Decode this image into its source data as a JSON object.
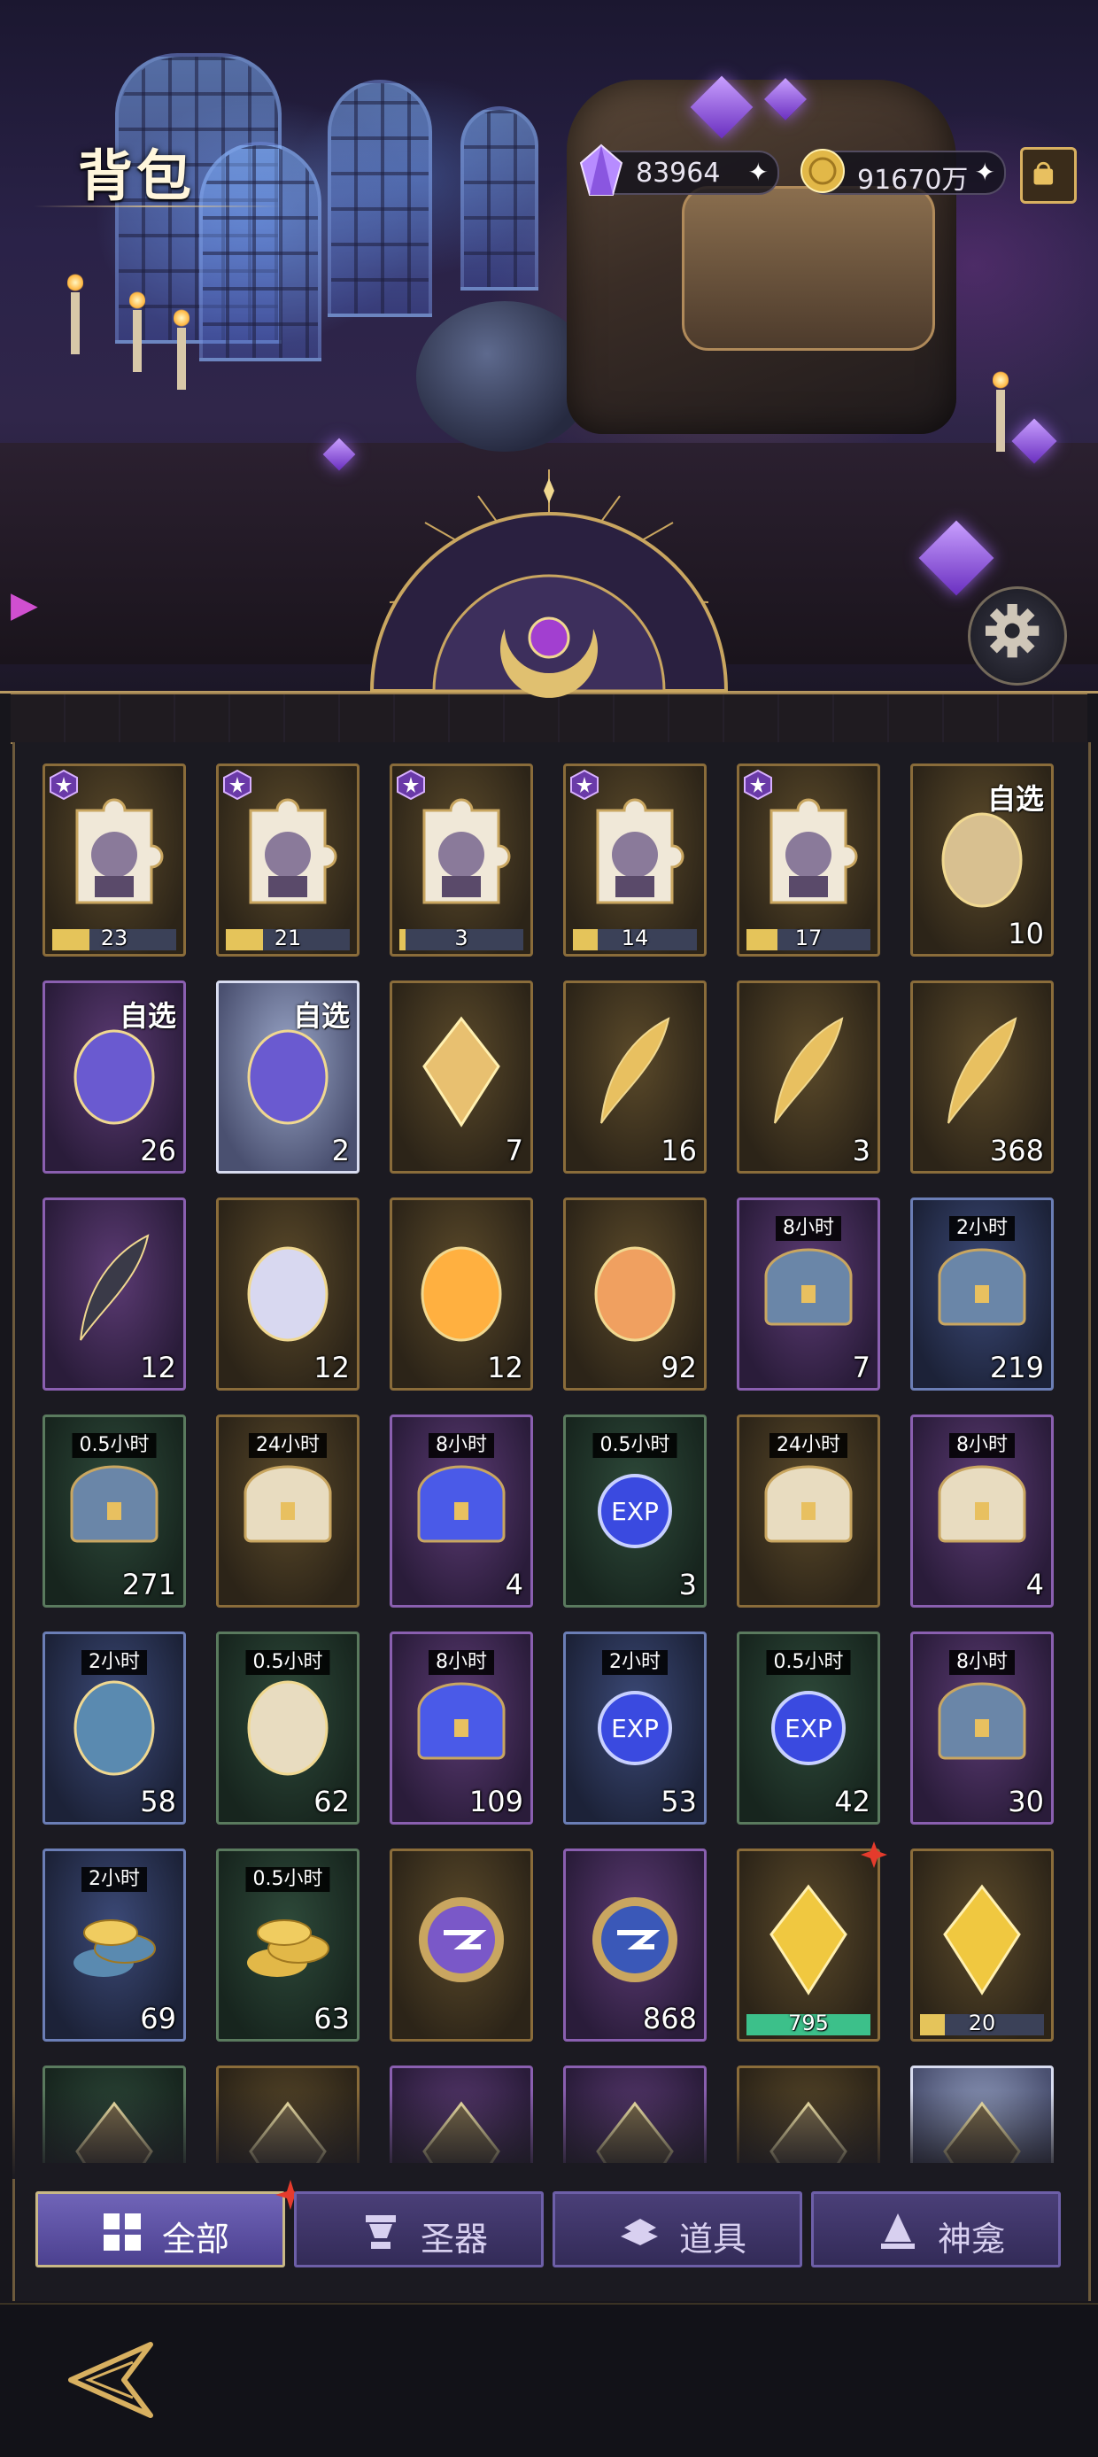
{
  "header": {
    "title": "背包",
    "crystal_amount": "83964",
    "coin_amount": "91670万"
  },
  "colors": {
    "gold_frame": "#8a6c3a",
    "purple_frame": "#8a5fb0",
    "blue_frame": "#6b7eb6",
    "green_frame": "#5a7a5e",
    "progress_gold": "#e5c45a",
    "progress_green": "#3cc08a",
    "tab_active": "#7064b8",
    "tab_inactive": "#4a3f78"
  },
  "inventory": {
    "rows": [
      [
        {
          "rarity": "gold",
          "icon": "puzzle-portrait-silver-hair-icon",
          "progress_label": "23",
          "progress": 0.3
        },
        {
          "rarity": "gold",
          "icon": "puzzle-portrait-dark-hair-icon",
          "progress_label": "21",
          "progress": 0.3
        },
        {
          "rarity": "gold",
          "icon": "puzzle-portrait-blonde-icon",
          "progress_label": "3",
          "progress": 0.05
        },
        {
          "rarity": "gold",
          "icon": "puzzle-portrait-black-hair-icon",
          "progress_label": "14",
          "progress": 0.2
        },
        {
          "rarity": "gold",
          "icon": "puzzle-portrait-dark-mask-icon",
          "progress_label": "17",
          "progress": 0.25
        },
        {
          "rarity": "gold",
          "icon": "golden-puzzle-icon",
          "pick": "自选",
          "count": "10"
        }
      ],
      [
        {
          "rarity": "purple",
          "icon": "tarot-card-icon",
          "pick": "自选",
          "count": "26"
        },
        {
          "rarity": "silver",
          "icon": "mystery-triangle-card-icon",
          "pick": "自选",
          "count": "2"
        },
        {
          "rarity": "gold",
          "icon": "crystal-key-icon",
          "count": "7"
        },
        {
          "rarity": "gold",
          "icon": "clover-feather-icon",
          "count": "16"
        },
        {
          "rarity": "gold",
          "icon": "star-feather-icon",
          "count": "3"
        },
        {
          "rarity": "gold",
          "icon": "golden-feather-icon",
          "count": "368"
        }
      ],
      [
        {
          "rarity": "purple",
          "icon": "dark-quill-icon",
          "count": "12"
        },
        {
          "rarity": "gold",
          "icon": "perfume-bottle-icon",
          "count": "12"
        },
        {
          "rarity": "gold",
          "icon": "fireworks-icon",
          "count": "12"
        },
        {
          "rarity": "gold",
          "icon": "conch-shell-icon",
          "count": "92"
        },
        {
          "rarity": "purple",
          "icon": "treasure-chest-icon",
          "tag": "8小时",
          "count": "7"
        },
        {
          "rarity": "blue",
          "icon": "treasure-chest-icon",
          "tag": "2小时",
          "count": "219"
        }
      ],
      [
        {
          "rarity": "green",
          "icon": "treasure-chest-icon",
          "tag": "0.5小时",
          "count": "271"
        },
        {
          "rarity": "gold",
          "icon": "open-chest-scrolls-icon",
          "tag": "24小时",
          "count": ""
        },
        {
          "rarity": "purple",
          "icon": "chest-exp-icon",
          "tag": "8小时",
          "count": "4"
        },
        {
          "rarity": "green",
          "icon": "scroll-exp-icon",
          "tag": "0.5小时",
          "count": "3"
        },
        {
          "rarity": "gold",
          "icon": "open-chest-scrolls-icon",
          "tag": "24小时",
          "count": ""
        },
        {
          "rarity": "purple",
          "icon": "chest-scroll-icon",
          "tag": "8小时",
          "count": "4"
        }
      ],
      [
        {
          "rarity": "blue",
          "icon": "pouch-scroll-icon",
          "tag": "2小时",
          "count": "58"
        },
        {
          "rarity": "green",
          "icon": "scroll-bundle-icon",
          "tag": "0.5小时",
          "count": "62"
        },
        {
          "rarity": "purple",
          "icon": "chest-exp-icon",
          "tag": "8小时",
          "count": "109"
        },
        {
          "rarity": "blue",
          "icon": "pouch-exp-icon",
          "tag": "2小时",
          "count": "53"
        },
        {
          "rarity": "green",
          "icon": "exp-orbs-icon",
          "tag": "0.5小时",
          "count": "42"
        },
        {
          "rarity": "purple",
          "icon": "golden-chest-icon",
          "tag": "8小时",
          "count": "30"
        }
      ],
      [
        {
          "rarity": "blue",
          "icon": "coin-pouch-icon",
          "tag": "2小时",
          "count": "69"
        },
        {
          "rarity": "green",
          "icon": "gold-coins-icon",
          "tag": "0.5小时",
          "count": "63"
        },
        {
          "rarity": "gold",
          "icon": "purple-medallion-icon",
          "count": ""
        },
        {
          "rarity": "purple",
          "icon": "blue-medallion-icon",
          "count": "868"
        },
        {
          "rarity": "gold",
          "icon": "yellow-crystal-icon",
          "progress_label": "795",
          "progress": 1.0,
          "progress_color": "green",
          "red_dot": true
        },
        {
          "rarity": "gold",
          "icon": "heart-crystal-icon",
          "progress_label": "20",
          "progress": 0.2
        }
      ],
      [
        {
          "rarity": "green",
          "icon": "crystal-shard-icon",
          "count": ""
        },
        {
          "rarity": "gold",
          "icon": "crystal-shard-icon",
          "count": ""
        },
        {
          "rarity": "purple",
          "icon": "crystal-shard-icon",
          "count": ""
        },
        {
          "rarity": "purple",
          "icon": "crystal-shard-icon",
          "count": ""
        },
        {
          "rarity": "gold",
          "icon": "crystal-shard-icon",
          "count": ""
        },
        {
          "rarity": "silver",
          "icon": "crystal-shard-icon",
          "count": ""
        }
      ]
    ]
  },
  "tabs": [
    {
      "label": "全部",
      "icon": "all-grid-icon",
      "active": true
    },
    {
      "label": "圣器",
      "icon": "relic-icon",
      "active": false
    },
    {
      "label": "道具",
      "icon": "items-stack-icon",
      "active": false
    },
    {
      "label": "神龛",
      "icon": "shrine-icon",
      "active": false
    }
  ]
}
